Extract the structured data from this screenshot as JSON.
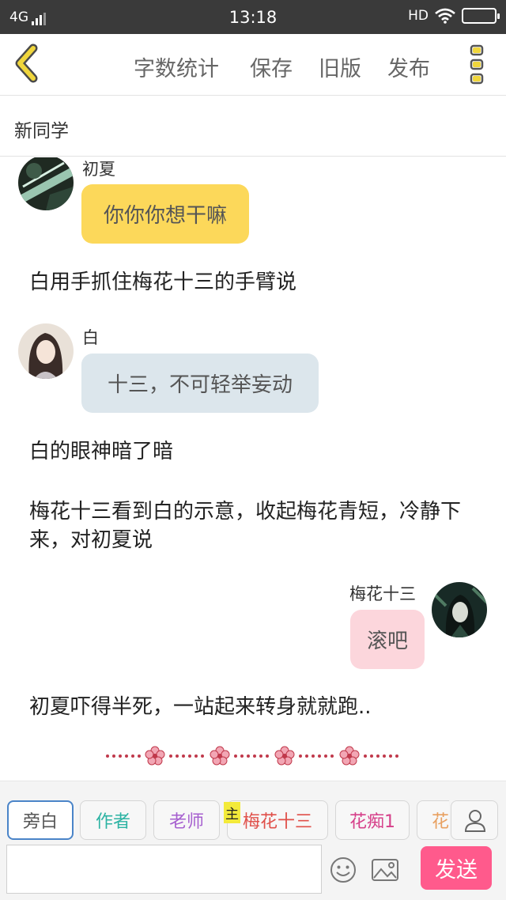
{
  "status_bar": {
    "network": "4G",
    "time": "13:18",
    "hd": "HD"
  },
  "toolbar": {
    "back_icon": "chevron-left-icon",
    "word_count": "字数统计",
    "save": "保存",
    "old_version": "旧版",
    "publish": "发布",
    "menu_icon": "vertical-dots-icon"
  },
  "document": {
    "title": "新同学"
  },
  "messages": [
    {
      "type": "dialogue",
      "side": "left",
      "speaker": "初夏",
      "text": "你你你想干嘛",
      "bubble_color": "#fcd85a"
    },
    {
      "type": "narration",
      "text": "白用手抓住梅花十三的手臂说"
    },
    {
      "type": "dialogue",
      "side": "left",
      "speaker": "白",
      "text": "十三，不可轻举妄动",
      "bubble_color": "#dce6ec"
    },
    {
      "type": "narration",
      "text": "白的眼神暗了暗"
    },
    {
      "type": "narration",
      "text": "梅花十三看到白的示意，收起梅花青短，冷静下来，对初夏说"
    },
    {
      "type": "dialogue",
      "side": "right",
      "speaker": "梅花十三",
      "text": "滚吧",
      "bubble_color": "#fcd6dc"
    },
    {
      "type": "narration",
      "text": "初夏吓得半死，一站起来转身就就跑.."
    }
  ],
  "divider": {
    "icon": "plum-blossom-divider",
    "color": "#c0394b"
  },
  "roles": [
    {
      "label": "旁白",
      "color": "#555555",
      "selected": true
    },
    {
      "label": "作者",
      "color": "#2cb3a3"
    },
    {
      "label": "老师",
      "color": "#a65fcf"
    },
    {
      "label": "梅花十三",
      "color": "#e0504a",
      "badge": "主"
    },
    {
      "label": "花痴1",
      "color": "#d6408a"
    },
    {
      "label": "花",
      "color": "#e8a060"
    }
  ],
  "input": {
    "placeholder": "",
    "value": "",
    "send_label": "发送"
  },
  "colors": {
    "accent_yellow": "#f0d63c",
    "send_pink": "#ff5a8c",
    "selected_tab_border": "#4a84c8"
  }
}
